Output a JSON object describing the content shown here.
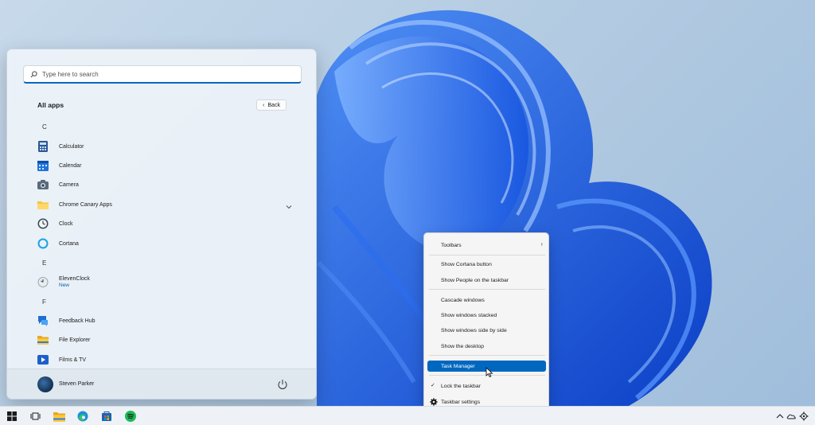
{
  "start_menu": {
    "search_placeholder": "Type here to search",
    "all_apps_title": "All apps",
    "back_label": "Back",
    "sections": [
      {
        "letter": "C"
      },
      {
        "letter": "E"
      },
      {
        "letter": "F"
      }
    ],
    "apps": [
      {
        "label": "Calculator",
        "icon": "calculator-icon"
      },
      {
        "label": "Calendar",
        "icon": "calendar-icon"
      },
      {
        "label": "Camera",
        "icon": "camera-icon"
      },
      {
        "label": "Chrome Canary Apps",
        "icon": "folder-icon"
      },
      {
        "label": "Clock",
        "icon": "clock-icon"
      },
      {
        "label": "Cortana",
        "icon": "cortana-icon"
      },
      {
        "label": "ElevenClock",
        "sublabel": "New",
        "icon": "elevenclock-icon"
      },
      {
        "label": "Feedback Hub",
        "icon": "feedback-hub-icon"
      },
      {
        "label": "File Explorer",
        "icon": "file-explorer-icon"
      },
      {
        "label": "Films & TV",
        "icon": "films-tv-icon"
      }
    ],
    "user_name": "Steven Parker"
  },
  "context_menu": {
    "items": [
      {
        "label": "Toolbars",
        "has_submenu": true
      },
      {
        "label": "Show Cortana button"
      },
      {
        "label": "Show People on the taskbar"
      },
      {
        "label": "Cascade windows"
      },
      {
        "label": "Show windows stacked"
      },
      {
        "label": "Show windows side by side"
      },
      {
        "label": "Show the desktop"
      },
      {
        "label": "Task Manager",
        "selected": true
      },
      {
        "label": "Lock the taskbar",
        "checked": true
      },
      {
        "label": "Taskbar settings",
        "icon": "gear-icon"
      }
    ]
  },
  "taskbar": {
    "apps": [
      "start-icon",
      "task-view-icon",
      "file-explorer-icon",
      "edge-icon",
      "store-icon",
      "spotify-icon"
    ],
    "tray": [
      "chevron-up-icon",
      "onedrive-icon",
      "settings-icon"
    ]
  },
  "colors": {
    "accent": "#0067c0",
    "wallpaper_blue": "#1a5fe0"
  }
}
